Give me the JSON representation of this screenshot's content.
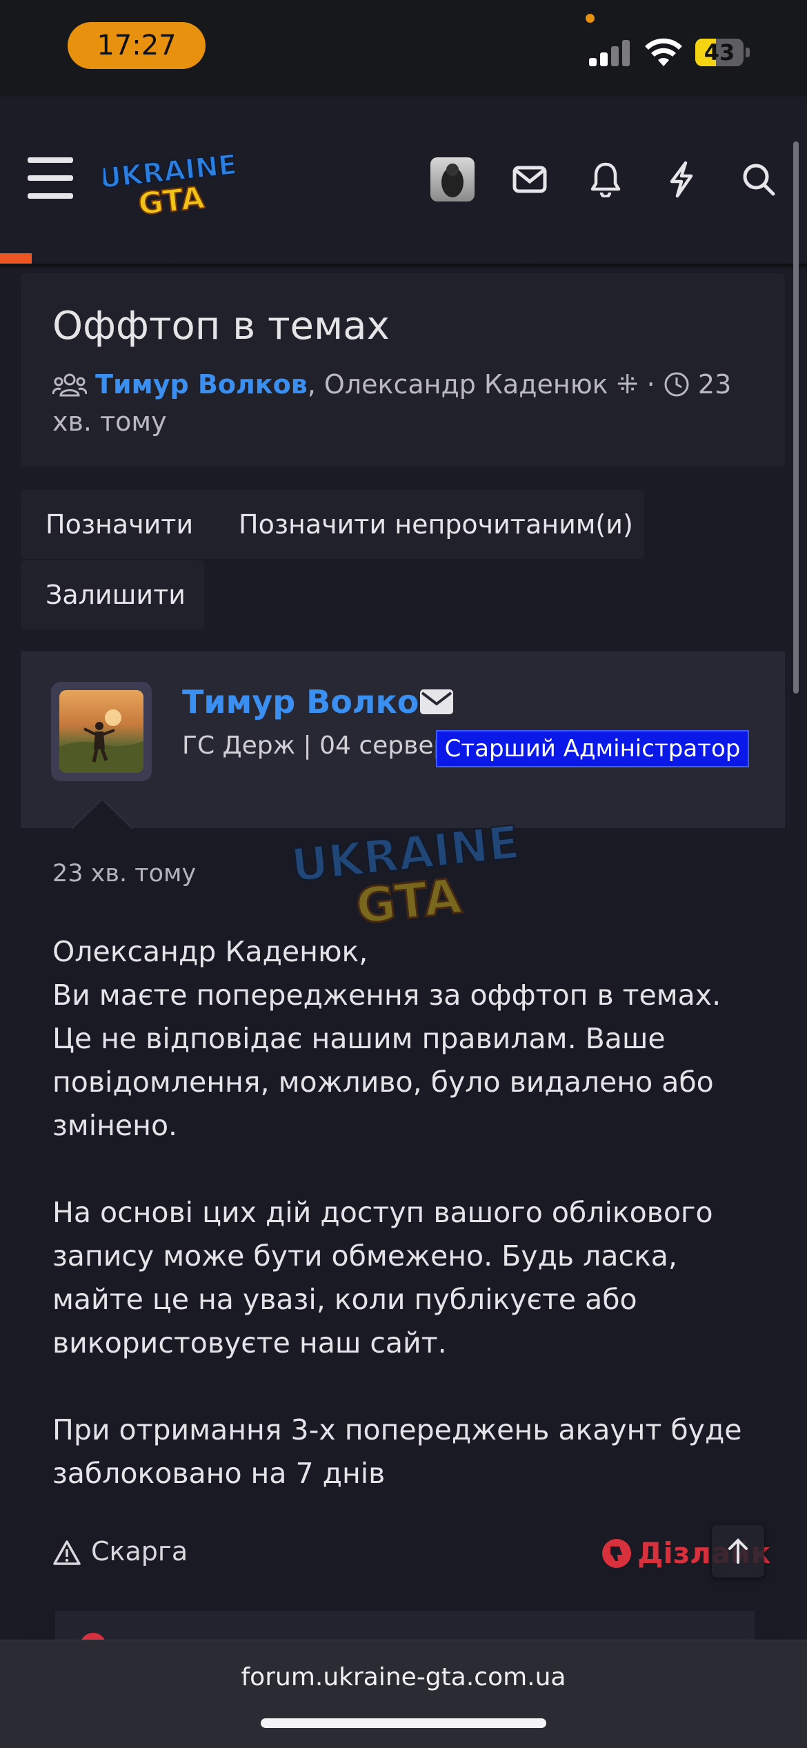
{
  "status_bar": {
    "time": "17:27",
    "battery": "43",
    "battery_level": 0.43
  },
  "header": {
    "logo_line1": "UKRAINE",
    "logo_line2": "GTA",
    "icons": [
      "menu-icon",
      "avatar",
      "mail-icon",
      "bell-icon",
      "bolt-icon",
      "search-icon"
    ]
  },
  "thread": {
    "title": "Оффтоп в темах",
    "author": "Тимур Волков",
    "participants_rest": ", Олександр Каденюк",
    "dot": " · ",
    "time": "23 хв. тому"
  },
  "actions": {
    "mark": "Позначити",
    "mark_unread": "Позначити непрочитаним(и)",
    "leave": "Залишити"
  },
  "message": {
    "poster_name": "Тимур Волков",
    "poster_sub": "ГС Держ | 04 сервер",
    "role": "Старший Адміністратор",
    "time": "23 хв. тому",
    "lines": [
      "Олександр Каденюк,",
      "Ви маєте попередження за оффтоп в темах. Це не відповідає нашим правилам. Ваше повідомлення, можливо, було видалено або змінено.",
      "На основі цих дій доступ вашого облікового запису може бути обмежено. Будь ласка, майте це на увазі, коли публікуєте або використовуєте наш сайт.",
      "При отримання 3-х попереджень акаунт буде заблоковано на 7 днів"
    ],
    "report": "Скарга",
    "dislike": "Дізлайк"
  },
  "browser": {
    "url": "forum.ukraine-gta.com.ua"
  },
  "colors": {
    "accent": "#3b8ff0",
    "role_badge": "#0a19e8",
    "dislike": "#d8303c",
    "time_pill": "#e8910f"
  }
}
